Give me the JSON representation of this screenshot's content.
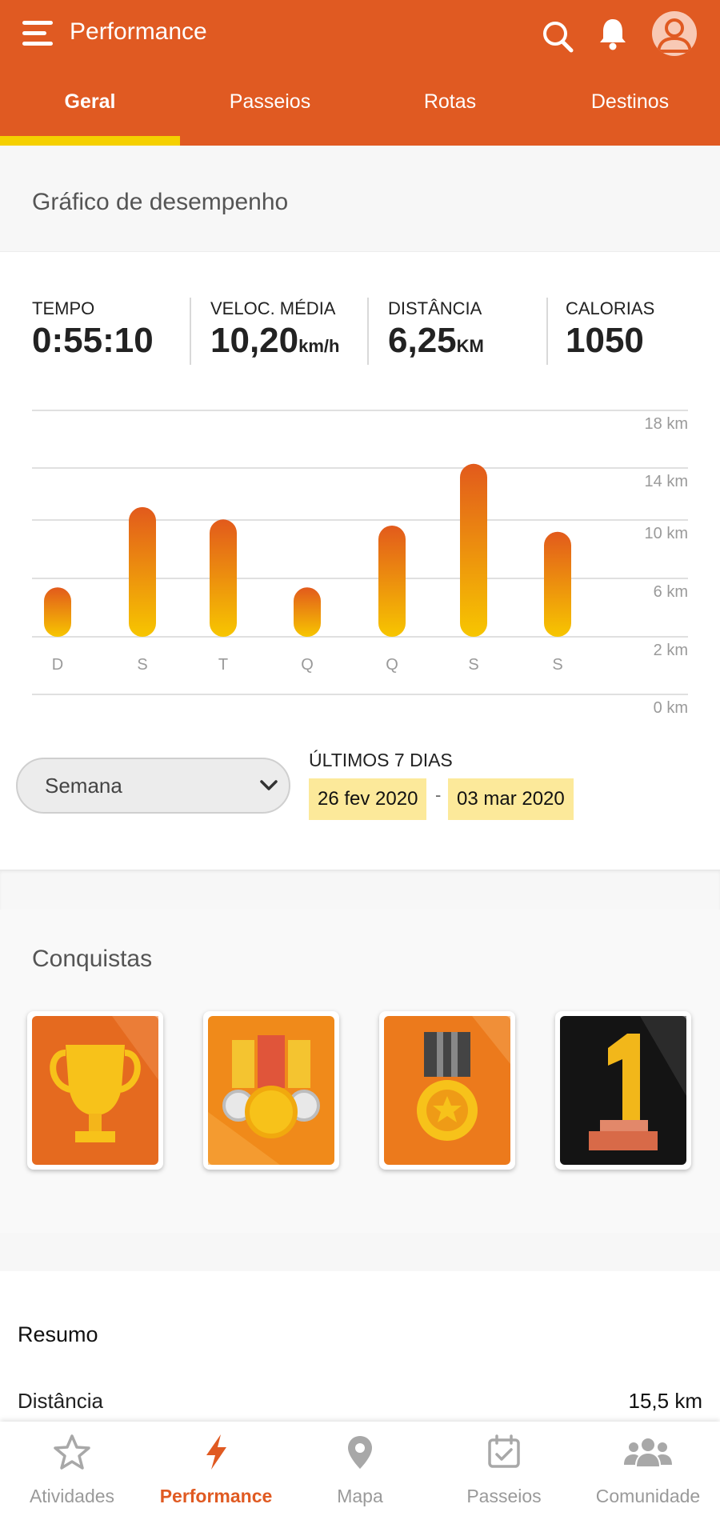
{
  "header": {
    "title": "Performance",
    "tabs": [
      {
        "label": "Geral",
        "active": true
      },
      {
        "label": "Passeios",
        "active": false
      },
      {
        "label": "Rotas",
        "active": false
      },
      {
        "label": "Destinos",
        "active": false
      }
    ],
    "icons": [
      "menu-icon",
      "search-icon",
      "bell-icon",
      "avatar-icon"
    ]
  },
  "performance": {
    "title": "Gráfico de desempenho",
    "stats": [
      {
        "label": "TEMPO",
        "value": "0:55:10",
        "unit": ""
      },
      {
        "label": "VELOC. MÉDIA",
        "value": "10,20",
        "unit": "km/h"
      },
      {
        "label": "DISTÂNCIA",
        "value": "6,25",
        "unit": "KM"
      },
      {
        "label": "CALORIAS",
        "value": "1050",
        "unit": ""
      }
    ],
    "period": {
      "selected": "Semana",
      "range_label": "ÚLTIMOS 7 DIAS",
      "start": "26 fev 2020",
      "end": "03 mar 2020",
      "separator": "-"
    }
  },
  "chart_data": {
    "type": "bar",
    "categories": [
      "D",
      "S",
      "T",
      "Q",
      "Q",
      "S",
      "S"
    ],
    "values": [
      4,
      10.5,
      9.5,
      4,
      9,
      14,
      8.5
    ],
    "ylim": [
      0,
      18
    ],
    "ytick_labels": [
      "18 km",
      "14 km",
      "10 km",
      "6 km",
      "2 km",
      "0 km"
    ],
    "grid": true
  },
  "achievements": {
    "title": "Conquistas",
    "badges": [
      "trophy-badge",
      "medals-badge",
      "star-medal-badge",
      "first-place-badge"
    ]
  },
  "summary": {
    "title": "Resumo",
    "rows": [
      {
        "label": "Distância",
        "value": "15,5 km"
      }
    ]
  },
  "bottom_nav": [
    {
      "label": "Atividades",
      "icon": "star-icon",
      "active": false
    },
    {
      "label": "Performance",
      "icon": "bolt-icon",
      "active": true
    },
    {
      "label": "Mapa",
      "icon": "map-pin-icon",
      "active": false
    },
    {
      "label": "Passeios",
      "icon": "calendar-check-icon",
      "active": false
    },
    {
      "label": "Comunidade",
      "icon": "group-icon",
      "active": false
    }
  ],
  "colors": {
    "primary": "#e05a22",
    "tab_indicator": "#f5d000",
    "bar_top": "#e25a1c",
    "bar_bottom": "#f7c600",
    "date_chip": "#fce99a"
  }
}
